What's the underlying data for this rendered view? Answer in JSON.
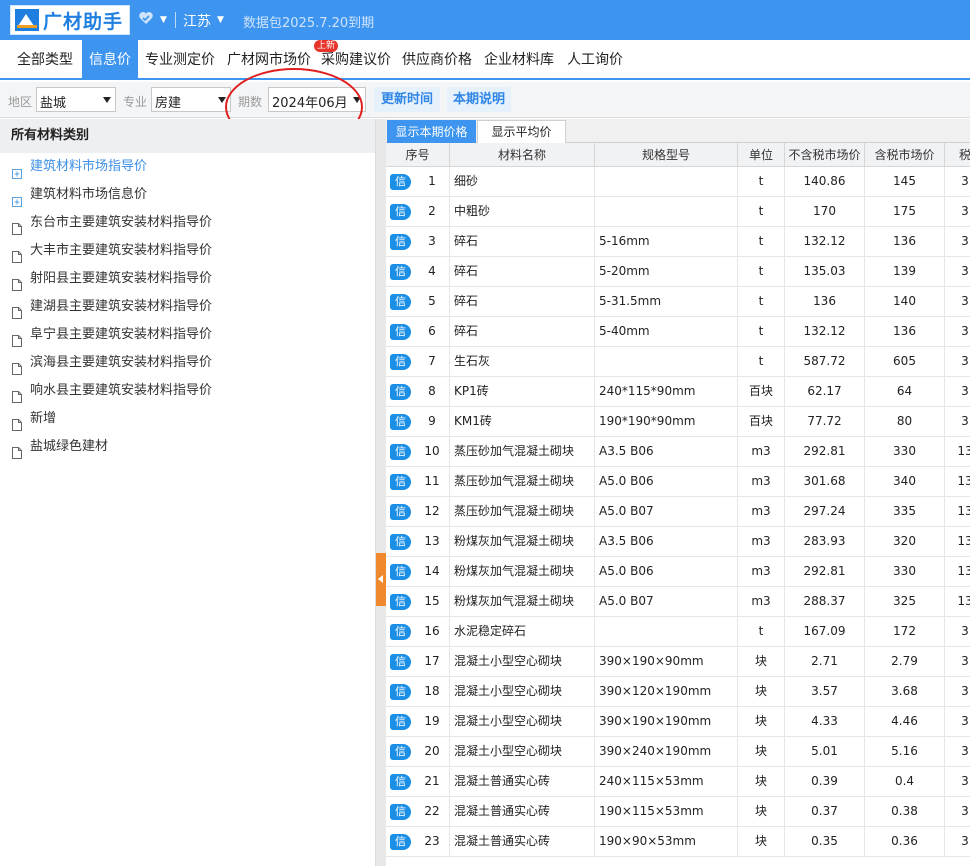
{
  "app": {
    "title": "广材助手",
    "region": "江苏",
    "package_notice": "数据包2025.7.20到期"
  },
  "nav": {
    "items": [
      "全部类型",
      "信息价",
      "专业测定价",
      "广材网市场价",
      "采购建议价",
      "供应商价格",
      "企业材料库",
      "人工询价"
    ],
    "active_index": 1,
    "new_badge": "上新"
  },
  "filters": {
    "area_label": "地区",
    "area_value": "盐城",
    "profession_label": "专业",
    "profession_value": "房建",
    "period_label": "期数",
    "period_value": "2024年06月",
    "update_time_button": "更新时间",
    "period_note_button": "本期说明"
  },
  "sidebar": {
    "header": "所有材料类别",
    "items": [
      {
        "label": "建筑材料市场指导价",
        "expandable": true,
        "highlight": true
      },
      {
        "label": "建筑材料市场信息价",
        "expandable": true,
        "highlight": false
      },
      {
        "label": "东台市主要建筑安装材料指导价",
        "expandable": false,
        "highlight": false
      },
      {
        "label": "大丰市主要建筑安装材料指导价",
        "expandable": false,
        "highlight": false
      },
      {
        "label": "射阳县主要建筑安装材料指导价",
        "expandable": false,
        "highlight": false
      },
      {
        "label": "建湖县主要建筑安装材料指导价",
        "expandable": false,
        "highlight": false
      },
      {
        "label": "阜宁县主要建筑安装材料指导价",
        "expandable": false,
        "highlight": false
      },
      {
        "label": "滨海县主要建筑安装材料指导价",
        "expandable": false,
        "highlight": false
      },
      {
        "label": "响水县主要建筑安装材料指导价",
        "expandable": false,
        "highlight": false
      },
      {
        "label": "新增",
        "expandable": false,
        "highlight": false
      },
      {
        "label": "盐城绿色建材",
        "expandable": false,
        "highlight": false
      }
    ]
  },
  "tabs": {
    "current": "显示本期价格",
    "average": "显示平均价"
  },
  "table": {
    "tag": "信",
    "columns": [
      "序号",
      "材料名称",
      "规格型号",
      "单位",
      "不含税市场价",
      "含税市场价",
      "税"
    ],
    "rows": [
      [
        "1",
        "细砂",
        "",
        "t",
        "140.86",
        "145",
        "3"
      ],
      [
        "2",
        "中粗砂",
        "",
        "t",
        "170",
        "175",
        "3"
      ],
      [
        "3",
        "碎石",
        "5-16mm",
        "t",
        "132.12",
        "136",
        "3"
      ],
      [
        "4",
        "碎石",
        "5-20mm",
        "t",
        "135.03",
        "139",
        "3"
      ],
      [
        "5",
        "碎石",
        "5-31.5mm",
        "t",
        "136",
        "140",
        "3"
      ],
      [
        "6",
        "碎石",
        "5-40mm",
        "t",
        "132.12",
        "136",
        "3"
      ],
      [
        "7",
        "生石灰",
        "",
        "t",
        "587.72",
        "605",
        "3"
      ],
      [
        "8",
        "KP1砖",
        "240*115*90mm",
        "百块",
        "62.17",
        "64",
        "3"
      ],
      [
        "9",
        "KM1砖",
        "190*190*90mm",
        "百块",
        "77.72",
        "80",
        "3"
      ],
      [
        "10",
        "蒸压砂加气混凝土砌块",
        "A3.5 B06",
        "m3",
        "292.81",
        "330",
        "13"
      ],
      [
        "11",
        "蒸压砂加气混凝土砌块",
        "A5.0 B06",
        "m3",
        "301.68",
        "340",
        "13"
      ],
      [
        "12",
        "蒸压砂加气混凝土砌块",
        "A5.0 B07",
        "m3",
        "297.24",
        "335",
        "13"
      ],
      [
        "13",
        "粉煤灰加气混凝土砌块",
        "A3.5 B06",
        "m3",
        "283.93",
        "320",
        "13"
      ],
      [
        "14",
        "粉煤灰加气混凝土砌块",
        "A5.0 B06",
        "m3",
        "292.81",
        "330",
        "13"
      ],
      [
        "15",
        "粉煤灰加气混凝土砌块",
        "A5.0 B07",
        "m3",
        "288.37",
        "325",
        "13"
      ],
      [
        "16",
        "水泥稳定碎石",
        "",
        "t",
        "167.09",
        "172",
        "3"
      ],
      [
        "17",
        "混凝土小型空心砌块",
        "390×190×90mm",
        "块",
        "2.71",
        "2.79",
        "3"
      ],
      [
        "18",
        "混凝土小型空心砌块",
        "390×120×190mm",
        "块",
        "3.57",
        "3.68",
        "3"
      ],
      [
        "19",
        "混凝土小型空心砌块",
        "390×190×190mm",
        "块",
        "4.33",
        "4.46",
        "3"
      ],
      [
        "20",
        "混凝土小型空心砌块",
        "390×240×190mm",
        "块",
        "5.01",
        "5.16",
        "3"
      ],
      [
        "21",
        "混凝土普通实心砖",
        "240×115×53mm",
        "块",
        "0.39",
        "0.4",
        "3"
      ],
      [
        "22",
        "混凝土普通实心砖",
        "190×115×53mm",
        "块",
        "0.37",
        "0.38",
        "3"
      ],
      [
        "23",
        "混凝土普通实心砖",
        "190×90×53mm",
        "块",
        "0.35",
        "0.36",
        "3"
      ]
    ]
  },
  "colors": {
    "brand": "#3d95f0",
    "annotation_circle": "#e02020",
    "collapse_handle": "#f0892d"
  }
}
